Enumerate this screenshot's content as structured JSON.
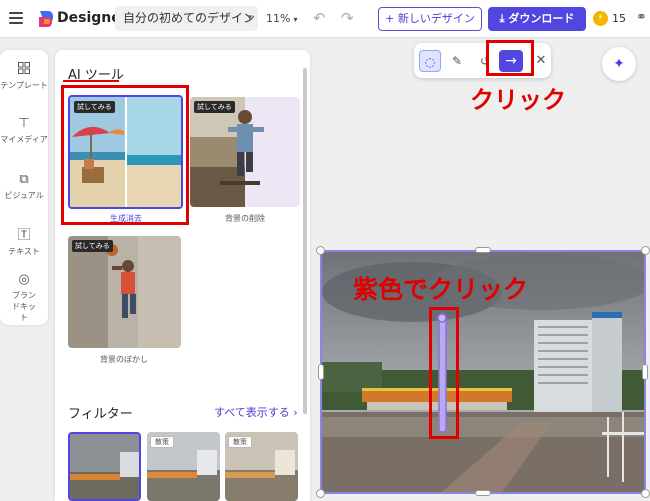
{
  "topbar": {
    "brand": "Designer",
    "doc_name": "自分の初めてのデザイン",
    "zoom": "11%",
    "new_design": "+ 新しいデザイン",
    "download": "ダウンロード",
    "credits": "15",
    "icons": [
      "menu-icon",
      "designer-logo",
      "chevron-down-icon",
      "undo-icon",
      "redo-icon",
      "download-icon",
      "coin-icon",
      "share-icon"
    ]
  },
  "rail": {
    "items": [
      {
        "label": "テンプレート",
        "icon": "template-icon"
      },
      {
        "label": "マイメディア",
        "icon": "upload-icon"
      },
      {
        "label": "ビジュアル",
        "icon": "visual-icon"
      },
      {
        "label": "テキスト",
        "icon": "text-icon"
      },
      {
        "label": "ブランドキット",
        "icon": "brand-icon"
      }
    ]
  },
  "panel": {
    "ai_title": "AI ツール",
    "badge": "試してみる",
    "cards": [
      {
        "label": "生成消去",
        "selected": true
      },
      {
        "label": "背景の削除",
        "selected": false
      },
      {
        "label": "背景のぼかし",
        "selected": false
      }
    ],
    "filters_title": "フィルター",
    "see_all": "すべて表示する",
    "filter_tags": [
      "",
      "散策",
      "散策"
    ]
  },
  "floating_toolbar": {
    "tools": [
      "lasso-icon",
      "brush-icon",
      "reset-icon",
      "arrow-right-icon",
      "close-icon"
    ]
  },
  "annotations": {
    "click": "クリック",
    "purple_click": "紫色でクリック",
    "color": "#e00000"
  },
  "colors": {
    "accent": "#5146e0",
    "annotation_red": "#e00000",
    "selection": "#8b85e6"
  }
}
